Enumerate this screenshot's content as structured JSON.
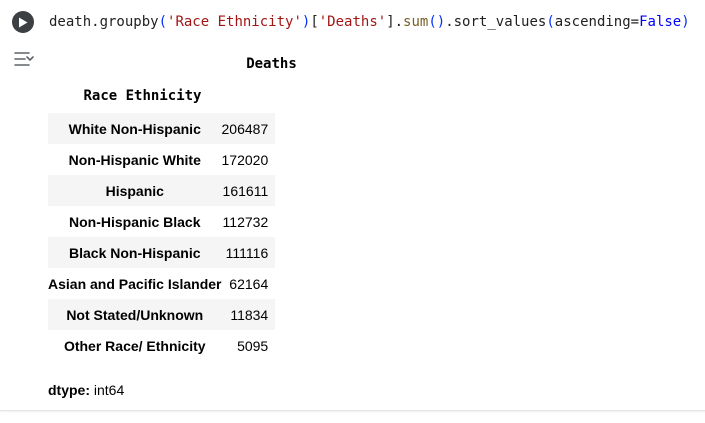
{
  "code": {
    "t1": "death.groupby",
    "t2": "(",
    "t3": "'Race Ethnicity'",
    "t4": ")",
    "t5": "[",
    "t6": "'Deaths'",
    "t7": "].",
    "t8": "sum",
    "t9": "()",
    "t10": ".sort_values",
    "t11": "(",
    "t12": "ascending=",
    "t13": "False",
    "t14": ")"
  },
  "output": {
    "column_header": "Deaths",
    "index_name": "Race Ethnicity",
    "rows": [
      {
        "label": "White Non-Hispanic",
        "value": "206487"
      },
      {
        "label": "Non-Hispanic White",
        "value": "172020"
      },
      {
        "label": "Hispanic",
        "value": "161611"
      },
      {
        "label": "Non-Hispanic Black",
        "value": "112732"
      },
      {
        "label": "Black Non-Hispanic",
        "value": "111116"
      },
      {
        "label": "Asian and Pacific Islander",
        "value": "62164"
      },
      {
        "label": "Not Stated/Unknown",
        "value": "11834"
      },
      {
        "label": "Other Race/ Ethnicity",
        "value": "5095"
      }
    ],
    "dtype_label": "dtype:",
    "dtype_value": " int64"
  },
  "icons": {
    "run": "play-icon",
    "output_options": "output-options-icon"
  },
  "colors": {
    "run_button": "#3c4043",
    "string": "#a31515",
    "keyword": "#0000ff",
    "function": "#795e26",
    "stripe": "#f5f5f5"
  }
}
